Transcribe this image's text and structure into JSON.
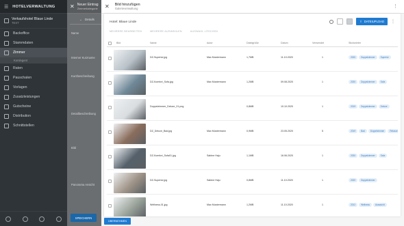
{
  "sidebar": {
    "app_title": "HOTELVERWALTUNG",
    "hotel_name": "Verkaufshotel Blaue Linde",
    "hotel_code": "TEST",
    "items": [
      {
        "label": "Backoffice",
        "icon": "dashboard-icon"
      },
      {
        "label": "Stammdaten",
        "icon": "database-icon"
      },
      {
        "label": "Zimmer",
        "icon": "bed-icon",
        "active": true
      },
      {
        "label": "Raten",
        "icon": "rates-icon"
      },
      {
        "label": "Pauschalen",
        "icon": "tag-icon"
      },
      {
        "label": "Vorlagen",
        "icon": "template-icon"
      },
      {
        "label": "Zusatzleistungen",
        "icon": "extras-icon"
      },
      {
        "label": "Gutscheine",
        "icon": "voucher-icon"
      },
      {
        "label": "Distribution",
        "icon": "distribution-icon"
      },
      {
        "label": "Schnittstellen",
        "icon": "interface-icon"
      }
    ],
    "sub_item": "Kontingent"
  },
  "panel2": {
    "title": "Neuer Eintrag",
    "subtitle": "Zimmerkategorie",
    "section": "Details",
    "save_label": "SPEICHERN"
  },
  "form_labels": [
    "Name",
    "Interner Kurzname",
    "Kurzbeschreibung",
    "Detailbeschreibung",
    "Bild",
    "Panorama Ansicht"
  ],
  "modal": {
    "title": "Bild hinzufügen",
    "subtitle": "Galerieverwaltung",
    "gallery_title": "Hotel: Blaue Linde",
    "upload_label": "DATEIUPLOAD",
    "actions": [
      "MEHRERE BEARBEITEN",
      "MEHRERE AUSWÄHLEN",
      "AUSWAHL LÖSCHEN"
    ],
    "columns": [
      "Bild",
      "Name",
      "Autor",
      "Dateigröße",
      "Datum",
      "Verwendet",
      "Stichwörter"
    ],
    "rows": [
      {
        "name": "DZ-Superior.jpg",
        "author": "Max Mustermann",
        "size": "1,7MB",
        "date": "11.10.2020",
        "used": "1",
        "tags": [
          "2020",
          "Doppelzimmer",
          "Superior"
        ],
        "thumb": "#b9c2c9"
      },
      {
        "name": "DZ-Komfort_Sofa.jpg",
        "author": "Max Mustermann",
        "size": "1,2MB",
        "date": "09.08.2020",
        "used": "1",
        "tags": [
          "2020",
          "Doppelzimmer",
          "Sofa"
        ],
        "thumb": "#6f8898"
      },
      {
        "name": "Doppelzimmer_Deluxe_01.png",
        "author": "",
        "size": "0,8MB",
        "date": "10.10.2020",
        "used": "1",
        "tags": [
          "2019",
          "Doppelzimmer",
          "Deluxe"
        ],
        "thumb": "#d9dde0"
      },
      {
        "name": "DZ_Deluxe_Bad.jpg",
        "author": "Max Mustermann",
        "size": "0,9MB",
        "date": "23.05.2020",
        "used": "5",
        "tags": [
          "2019",
          "Bad",
          "Doppelzimmer",
          "Relaxzeit"
        ],
        "thumb": "#8a6d5c"
      },
      {
        "name": "DZ-Komfort_Sofa01.jpg",
        "author": "Sabine Haju",
        "size": "1,1MB",
        "date": "16.06.2020",
        "used": "1",
        "tags": [
          "2020",
          "Doppelzimmer",
          "Sofa"
        ],
        "thumb": "#55606a"
      },
      {
        "name": "DZ-Superior.jpg",
        "author": "Sabine Haju",
        "size": "0,8MB",
        "date": "11.10.2020",
        "used": "1",
        "tags": [
          "2020",
          "Doppelzimmer"
        ],
        "thumb": "#a09488"
      },
      {
        "name": "Wellness-01.jpg",
        "author": "Max Mustermann",
        "size": "1,2MB",
        "date": "11.10.2020",
        "used": "1",
        "tags": [
          "2012",
          "Wellness",
          "Ausssicht"
        ],
        "thumb": "#9aa39a"
      }
    ],
    "footer_label": "ÜBERNEHMEN"
  },
  "colors": {
    "accent": "#1f7bd1",
    "sidebar": "#2f3438",
    "tag_bg": "#e3eef8"
  }
}
